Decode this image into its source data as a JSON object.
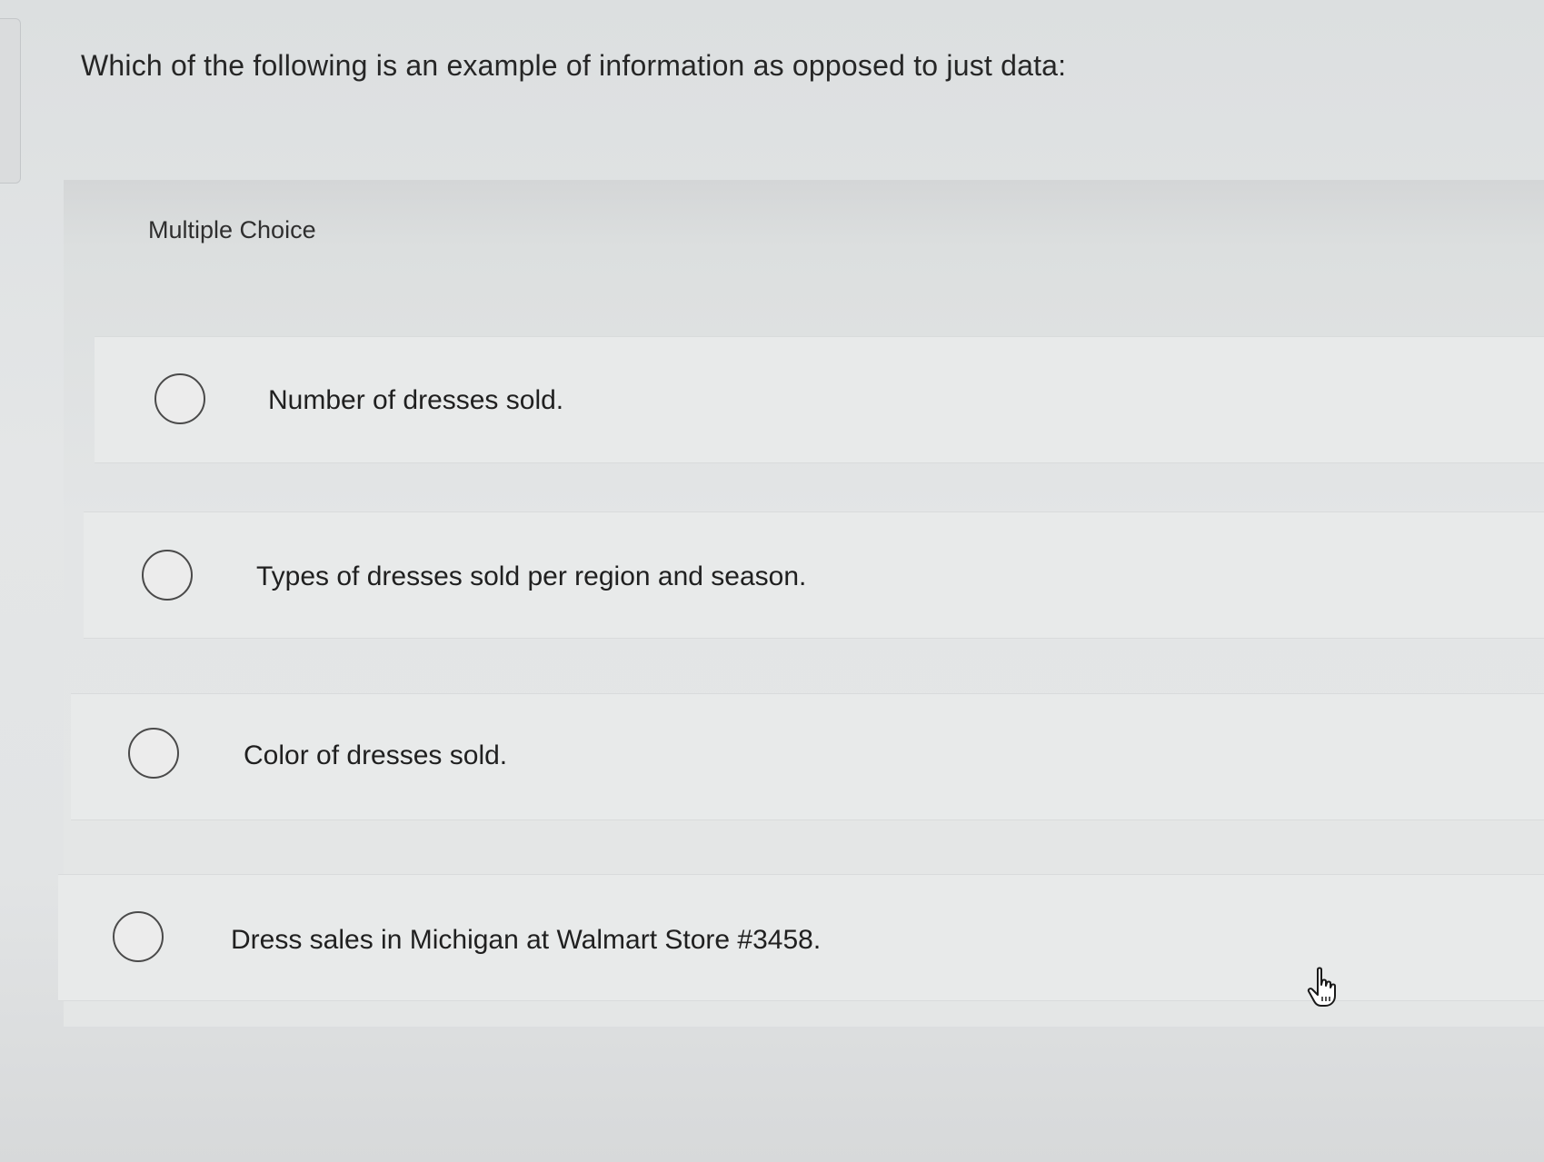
{
  "question": {
    "text": "Which of the following is an example of information as opposed to just data:"
  },
  "question_type": {
    "label": "Multiple Choice"
  },
  "options": [
    {
      "label": "Number of dresses sold.",
      "selected": false
    },
    {
      "label": "Types of dresses sold per region and season.",
      "selected": false
    },
    {
      "label": "Color of dresses sold.",
      "selected": false
    },
    {
      "label": "Dress sales in Michigan at Walmart Store #3458.",
      "selected": false
    }
  ],
  "icons": {
    "cursor": "hand-pointer-icon"
  },
  "colors": {
    "background": "#e2e4e5",
    "row_background": "#e8eaea",
    "radio_border": "#4a4a4a",
    "text": "#202020"
  }
}
